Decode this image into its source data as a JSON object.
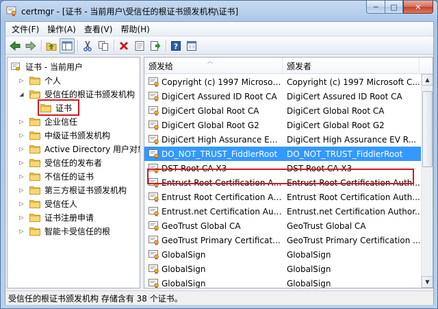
{
  "window": {
    "title": "certmgr - [证书 - 当前用户\\受信任的根证书颁发机构\\证书]",
    "minimize": "─",
    "maximize": "□",
    "close": "✕"
  },
  "menu": [
    {
      "label": "文件(F)"
    },
    {
      "label": "操作(A)"
    },
    {
      "label": "查看(V)"
    },
    {
      "label": "帮助(H)"
    }
  ],
  "toolbar": {
    "buttons": [
      "back-arrow-icon",
      "forward-arrow-icon",
      "up-folder-icon",
      "show-hide-tree-icon",
      "cut-icon",
      "copy-icon",
      "delete-icon",
      "properties-icon",
      "export-icon",
      "help-icon",
      "mmc-icon"
    ]
  },
  "tree": {
    "root": "证书 - 当前用户",
    "items": [
      {
        "label": "个人"
      },
      {
        "label": "受信任的根证书颁发机构"
      },
      {
        "label": "证书"
      },
      {
        "label": "企业信任"
      },
      {
        "label": "中级证书颁发机构"
      },
      {
        "label": "Active Directory 用户对象"
      },
      {
        "label": "受信任的发布者"
      },
      {
        "label": "不信任的证书"
      },
      {
        "label": "第三方根证书颁发机构"
      },
      {
        "label": "受信任人"
      },
      {
        "label": "证书注册申请"
      },
      {
        "label": "智能卡受信任的根"
      }
    ]
  },
  "list": {
    "headers": {
      "issued_to": "颁发给",
      "issued_by": "颁发者"
    },
    "rows": [
      {
        "issued_to": "Copyright (c) 1997 Microsoft...",
        "issued_by": "Copyright (c) 1997 Microsoft C..."
      },
      {
        "issued_to": "DigiCert Assured ID Root CA",
        "issued_by": "DigiCert Assured ID Root CA"
      },
      {
        "issued_to": "DigiCert Global Root CA",
        "issued_by": "DigiCert Global Root CA"
      },
      {
        "issued_to": "DigiCert Global Root G2",
        "issued_by": "DigiCert Global Root G2"
      },
      {
        "issued_to": "DigiCert High Assurance EV ...",
        "issued_by": "DigiCert High Assurance EV R..."
      },
      {
        "issued_to": "DO_NOT_TRUST_FiddlerRoot",
        "issued_by": "DO_NOT_TRUST_FiddlerRoot"
      },
      {
        "issued_to": "DST Root CA X3",
        "issued_by": "DST Root CA X3"
      },
      {
        "issued_to": "Entrust Root Certification Au...",
        "issued_by": "Entrust Root Certification Auth..."
      },
      {
        "issued_to": "Entrust Root Certification Au...",
        "issued_by": "Entrust Root Certification Auth..."
      },
      {
        "issued_to": "Entrust.net Certification Auth...",
        "issued_by": "Entrust.net Certification Author..."
      },
      {
        "issued_to": "GeoTrust Global CA",
        "issued_by": "GeoTrust Global CA"
      },
      {
        "issued_to": "GeoTrust Primary Certificatio...",
        "issued_by": "GeoTrust Primary Certification ..."
      },
      {
        "issued_to": "GlobalSign",
        "issued_by": "GlobalSign"
      },
      {
        "issued_to": "GlobalSign",
        "issued_by": "GlobalSign"
      },
      {
        "issued_to": "GlobalSign",
        "issued_by": "GlobalSign"
      }
    ]
  },
  "scrollbar": {
    "up": "▲",
    "down": "▼",
    "position": 0.05,
    "visible_fraction": 0.4
  },
  "status": "受信任的根证书颁发机构 存储含有 38 个证书。",
  "colors": {
    "selection": "#3399ff",
    "highlight_frame": "#d0191f",
    "folder": "#f2c84b"
  }
}
